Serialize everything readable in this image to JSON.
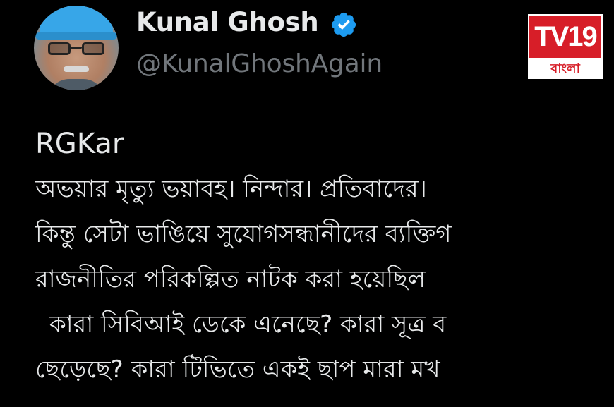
{
  "profile": {
    "name": "Kunal Ghosh",
    "handle": "@KunalGhoshAgain",
    "verified_color": "#1d9bf0"
  },
  "logo": {
    "main": "TV19",
    "sub": "বাংলা",
    "color": "#d71e28"
  },
  "tweet": {
    "lines": [
      "RGKar",
      "অভয়ার মৃত্যু ভয়াবহ। নিন্দার। প্রতিবাদের।",
      "কিন্তু সেটা ভাঙিয়ে সুযোগসন্ধানীদের ব্যক্তিগ",
      "রাজনীতির পরিকল্পিত নাটক করা হয়েছিল",
      "কারা সিবিআই ডেকে এনেছে? কারা সূত্র ব",
      "ছেড়েছে? কারা টিভিতে একই ছাপ মারা মখ"
    ]
  }
}
